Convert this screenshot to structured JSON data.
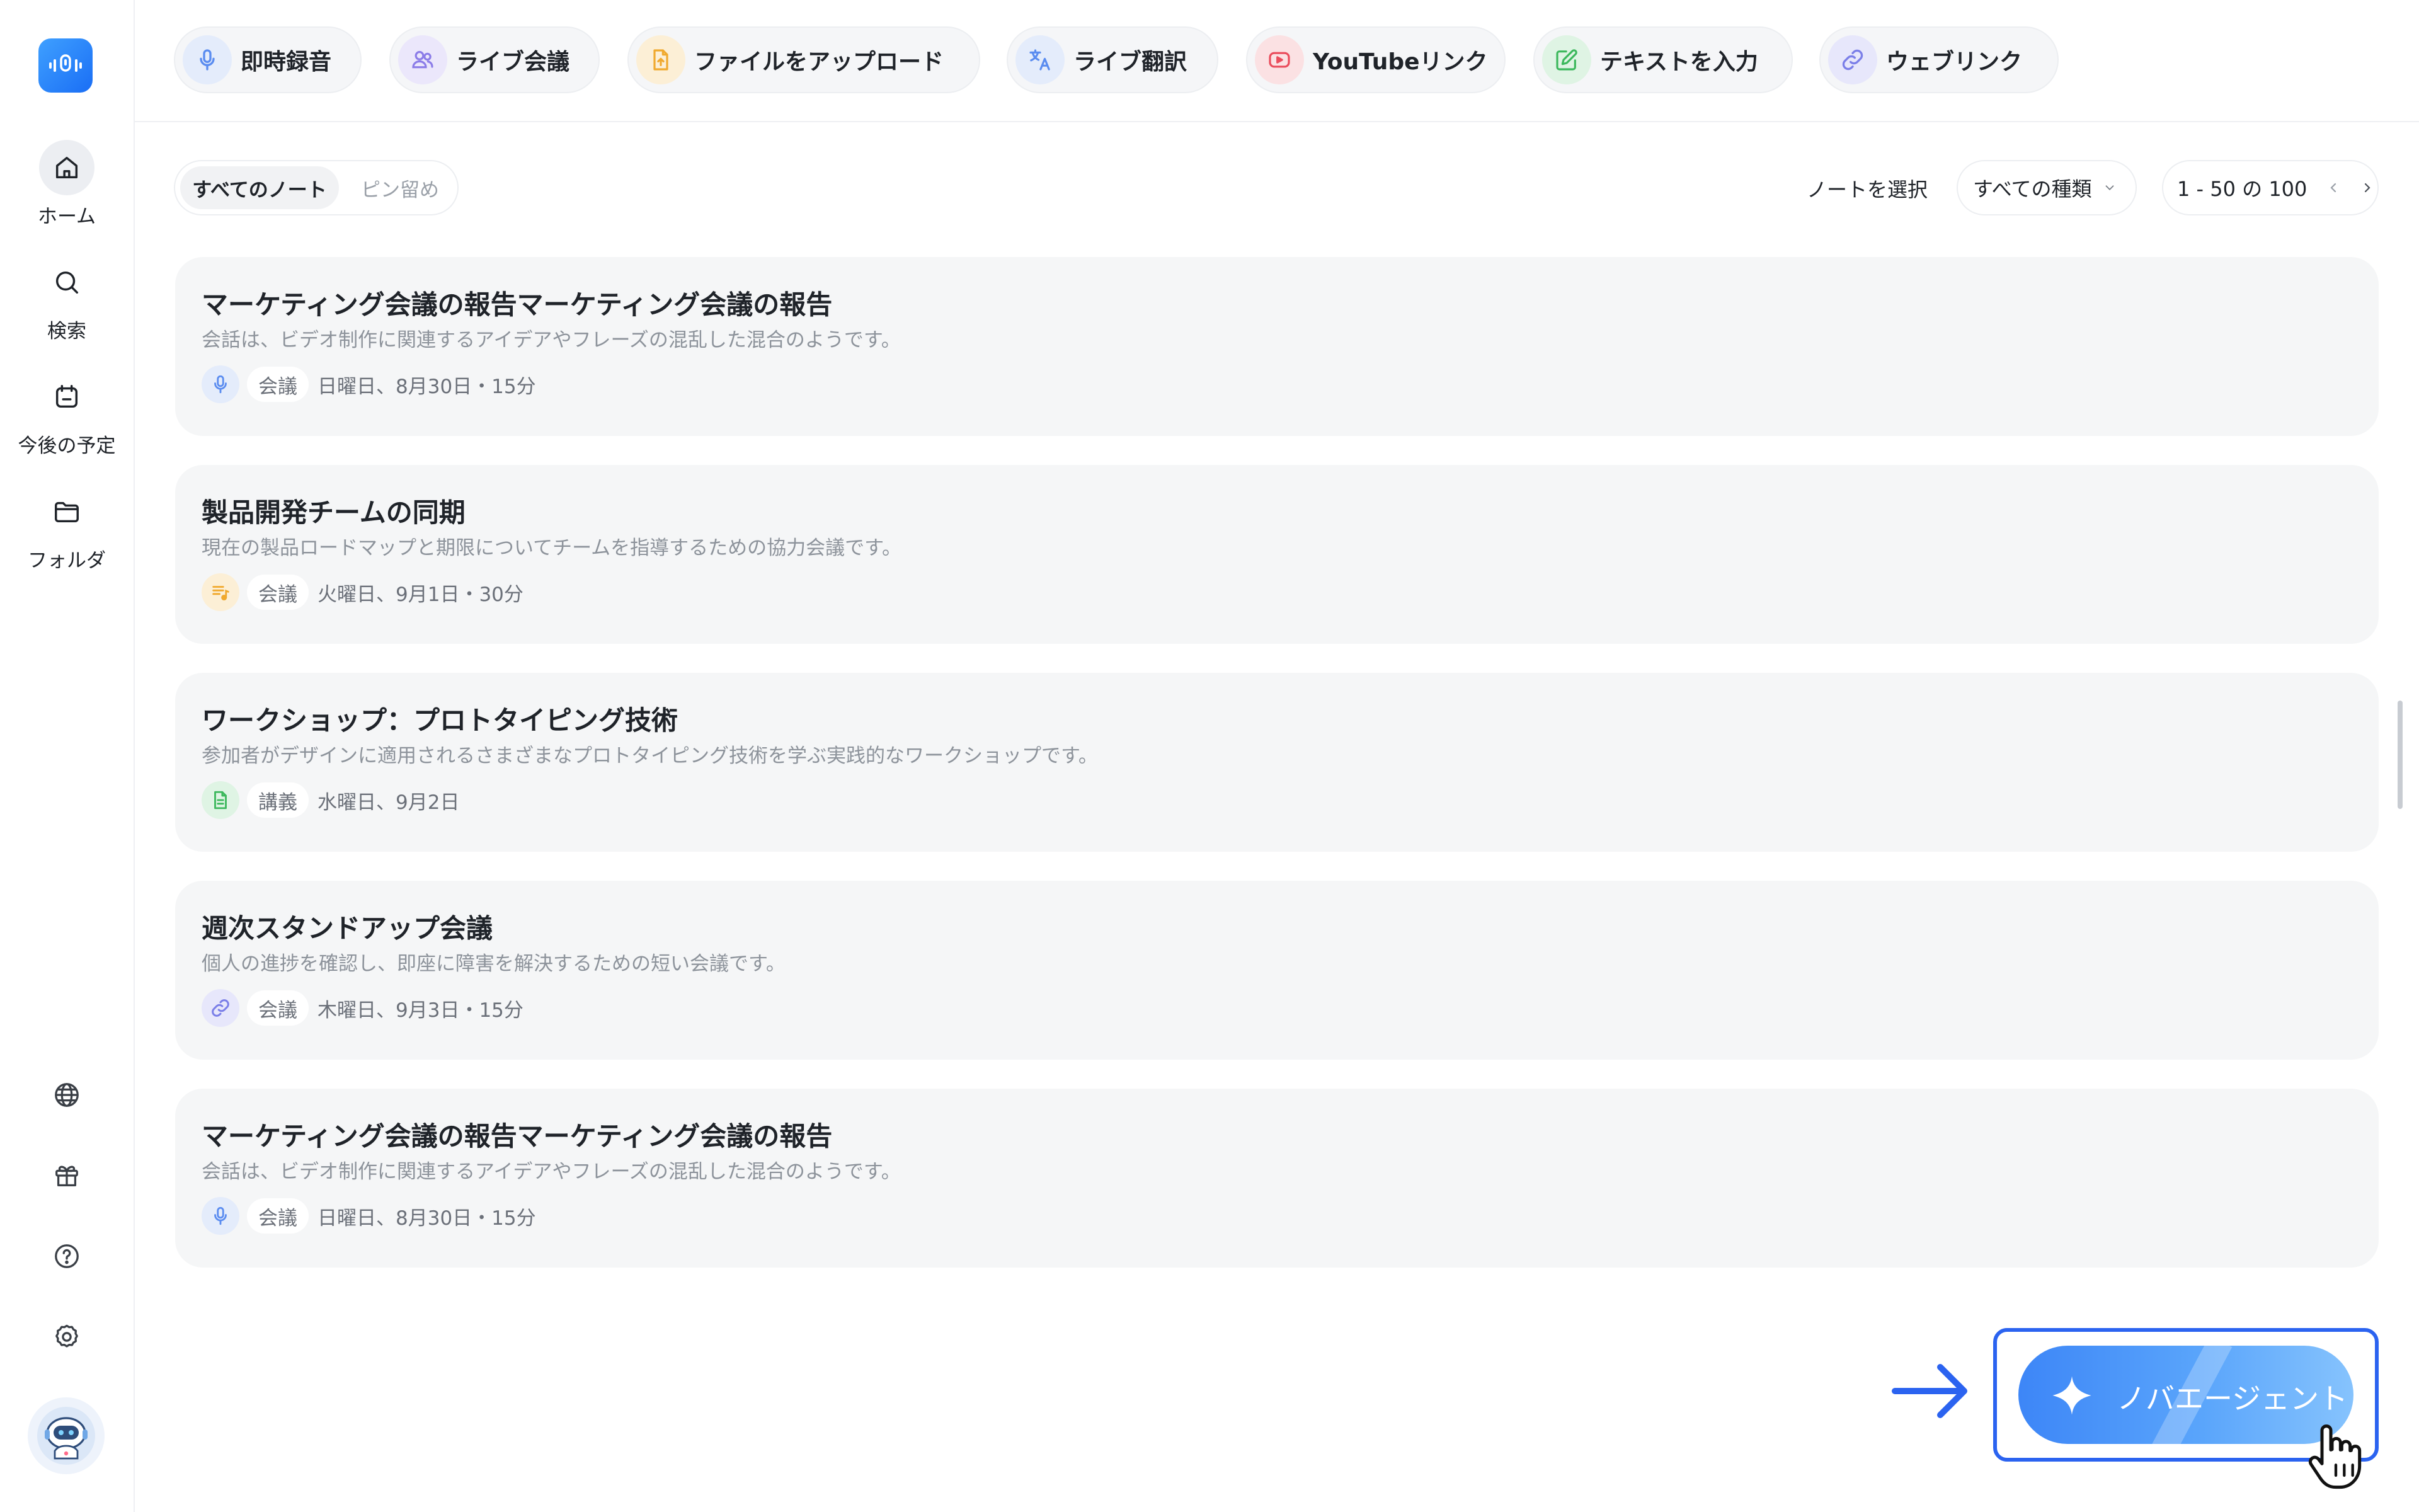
{
  "sidebar": {
    "items": [
      {
        "label": "ホーム",
        "icon": "home-icon"
      },
      {
        "label": "検索",
        "icon": "search-icon"
      },
      {
        "label": "今後の予定",
        "icon": "calendar-icon"
      },
      {
        "label": "フォルダ",
        "icon": "folder-icon"
      }
    ],
    "bottom_icons": [
      "globe-icon",
      "gift-icon",
      "help-icon",
      "settings-icon"
    ]
  },
  "actions": [
    {
      "label": "即時録音",
      "icon": "mic-icon",
      "color": "#5a8cf0",
      "bg": "#e4ecfb"
    },
    {
      "label": "ライブ会議",
      "icon": "people-icon",
      "color": "#8b7ce8",
      "bg": "#ebe7fb"
    },
    {
      "label": "ファイルをアップロード",
      "icon": "upload-file-icon",
      "color": "#f0a92e",
      "bg": "#fcefd6"
    },
    {
      "label": "ライブ翻訳",
      "icon": "translate-icon",
      "color": "#5a8cf0",
      "bg": "#e4ecfb"
    },
    {
      "label": "YouTubeリンク",
      "icon": "youtube-icon",
      "color": "#ea4c5c",
      "bg": "#fbe1e3"
    },
    {
      "label": "テキストを入力",
      "icon": "edit-text-icon",
      "color": "#3cb85c",
      "bg": "#dff4e4"
    },
    {
      "label": "ウェブリンク",
      "icon": "link-icon",
      "color": "#7b7fe8",
      "bg": "#e7e7fb"
    }
  ],
  "filters": {
    "tabs": [
      "すべてのノート",
      "ピン留め"
    ],
    "select_notes": "ノートを選択",
    "type_filter": "すべての種類",
    "pagination": "1 - 50 の 100"
  },
  "notes": [
    {
      "title": "マーケティング会議の報告マーケティング会議の報告",
      "desc": "会話は、ビデオ制作に関連するアイデアやフレーズの混乱した混合のようです。",
      "icon": "mic-icon",
      "tag": "会議",
      "date": "日曜日、8月30日・15分"
    },
    {
      "title": "製品開発チームの同期",
      "desc": "現在の製品ロードマップと期限についてチームを指導するための協力会議です。",
      "icon": "audio-file-icon",
      "tag": "会議",
      "date": "火曜日、9月1日・30分"
    },
    {
      "title": "ワークショップ：プロトタイピング技術",
      "desc": "参加者がデザインに適用されるさまざまなプロトタイピング技術を学ぶ実践的なワークショップです。",
      "icon": "document-icon",
      "tag": "講義",
      "date": "水曜日、9月2日"
    },
    {
      "title": "週次スタンドアップ会議",
      "desc": "個人の進捗を確認し、即座に障害を解決するための短い会議です。",
      "icon": "link-icon",
      "tag": "会議",
      "date": "木曜日、9月3日・15分"
    },
    {
      "title": "マーケティング会議の報告マーケティング会議の報告",
      "desc": "会話は、ビデオ制作に関連するアイデアやフレーズの混乱した混合のようです。",
      "icon": "mic-icon",
      "tag": "会議",
      "date": "日曜日、8月30日・15分"
    }
  ],
  "agent_button": {
    "label": "ノバエージェント"
  },
  "colors": {
    "accent": "#2b63f0",
    "card_bg": "#f5f6f7"
  }
}
